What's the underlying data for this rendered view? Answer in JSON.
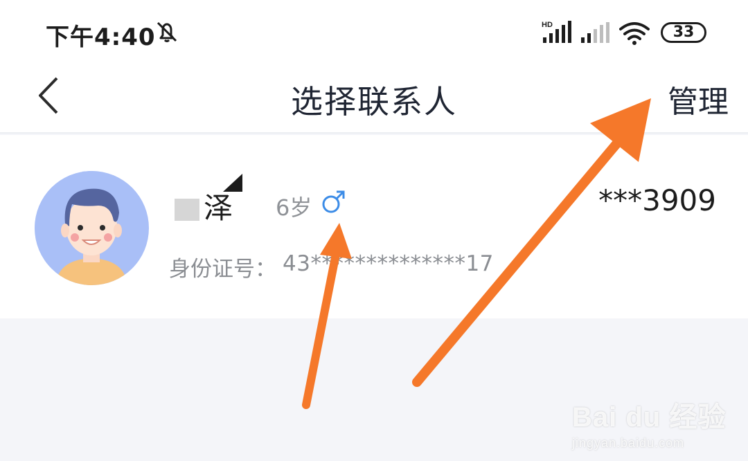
{
  "status_bar": {
    "time": "下午4:40",
    "battery": "33",
    "icons": [
      "mute-bell-icon",
      "hd-signal-icon",
      "signal-icon",
      "wifi-icon",
      "battery-icon"
    ]
  },
  "nav": {
    "back_icon": "chevron-left-icon",
    "title": "选择联系人",
    "manage_label": "管理"
  },
  "contact": {
    "name": "泽",
    "age": "6岁",
    "gender_icon": "male-icon",
    "gender_color": "#3c8ce7",
    "phone": "***3909",
    "id_label": "身份证号：",
    "id_value": "43**************17"
  },
  "colors": {
    "arrow": "#f5782a",
    "background": "#f4f5f9",
    "title_text": "#1f2533"
  },
  "watermark": {
    "logo": "Bai du 经验",
    "url": "jingyan.baidu.com"
  }
}
